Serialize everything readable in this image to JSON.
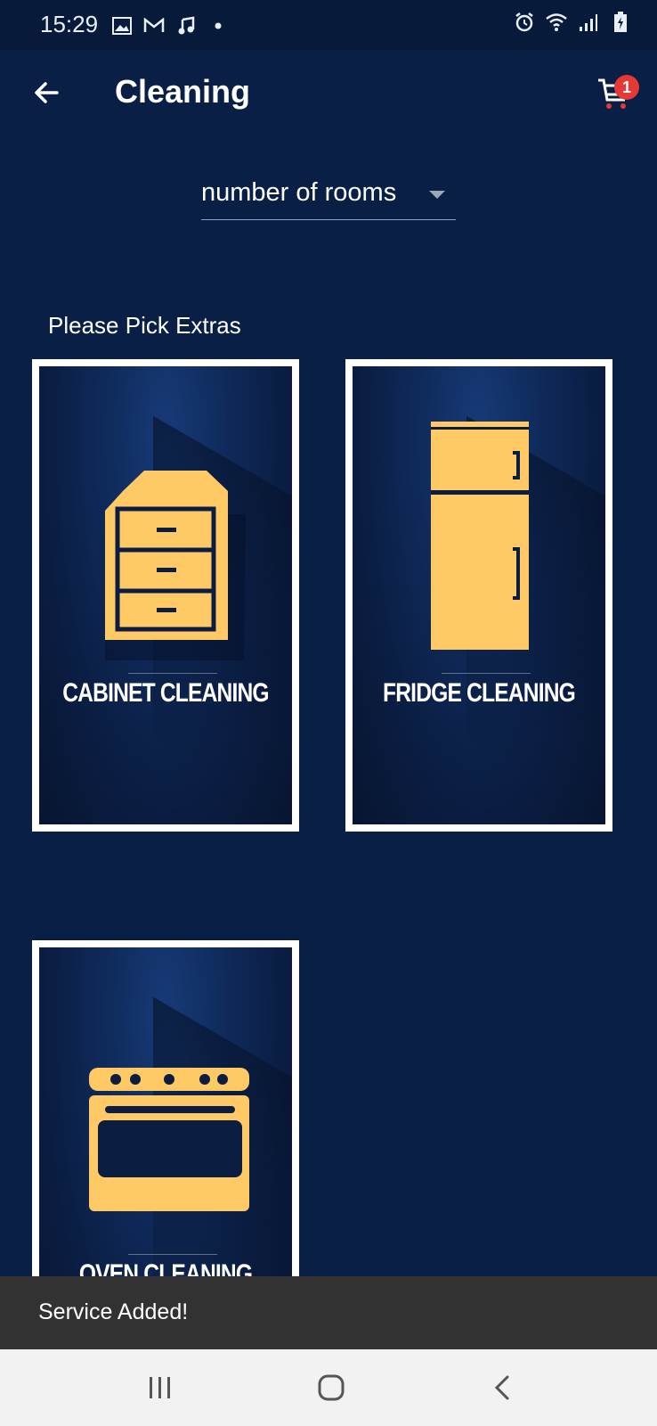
{
  "status_bar": {
    "time": "15:29",
    "left_icons": [
      "image-icon",
      "gmail-icon",
      "music-icon",
      "dot-icon"
    ],
    "right_icons": [
      "alarm-icon",
      "wifi-icon",
      "signal-icon",
      "battery-icon"
    ]
  },
  "app_bar": {
    "title": "Cleaning",
    "back_icon": "arrow-left-icon",
    "cart_icon": "cart-icon",
    "cart_count": "1"
  },
  "rooms_select": {
    "label": "number of rooms"
  },
  "extras": {
    "heading": "Please Pick Extras",
    "items": [
      {
        "label": "CABINET CLEANING",
        "icon": "cabinet-icon"
      },
      {
        "label": "FRIDGE CLEANING",
        "icon": "fridge-icon"
      },
      {
        "label": "OVEN CLEANING",
        "icon": "oven-icon"
      }
    ]
  },
  "snackbar": {
    "message": "Service Added!"
  },
  "nav": {
    "recents_icon": "recents-icon",
    "home_icon": "home-icon",
    "back_icon": "back-chevron-icon"
  },
  "colors": {
    "background": "#0a1f45",
    "accent": "#ffc966",
    "badge": "#e53935",
    "snackbar": "#323232"
  }
}
